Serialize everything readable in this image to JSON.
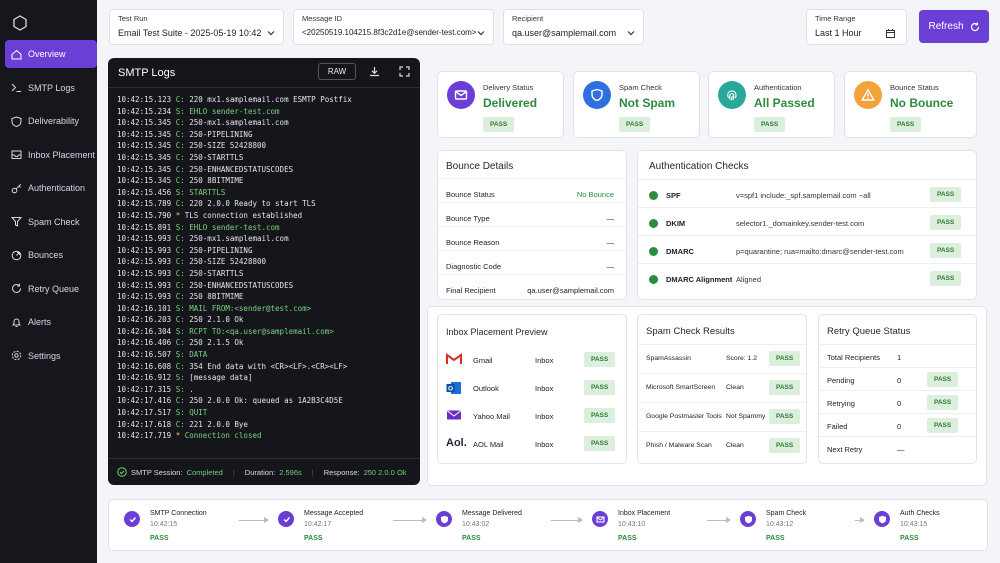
{
  "sidebar": {
    "items": [
      {
        "label": "Overview",
        "icon": "home-icon"
      },
      {
        "label": "SMTP Logs",
        "icon": "terminal-icon"
      },
      {
        "label": "Deliverability",
        "icon": "shield-icon"
      },
      {
        "label": "Inbox Placement",
        "icon": "inbox-icon"
      },
      {
        "label": "Authentication",
        "icon": "key-icon"
      },
      {
        "label": "Spam Check",
        "icon": "filter-icon"
      },
      {
        "label": "Bounces",
        "icon": "bounce-icon"
      },
      {
        "label": "Retry Queue",
        "icon": "retry-icon"
      },
      {
        "label": "Alerts",
        "icon": "bell-icon"
      },
      {
        "label": "Settings",
        "icon": "gear-icon"
      }
    ],
    "accent": "#6b3fd6"
  },
  "filters": {
    "test_run": {
      "label": "Test Run",
      "value": "Email Test Suite - 2025-05-19 10:42"
    },
    "message_id": {
      "label": "Message ID",
      "value": "<20250519.104215.8f3c2d1e@sender-test.com>"
    },
    "recipient": {
      "label": "Recipient",
      "value": "qa.user@samplemail.com"
    },
    "time_range": {
      "label": "Time Range",
      "value": "Last 1 Hour"
    },
    "refresh_label": "Refresh"
  },
  "logs": {
    "title": "SMTP Logs",
    "raw_label": "RAW",
    "lines": [
      {
        "t": "10:42:15.123",
        "tag": "C:",
        "msg": "220 mx1.samplemail.com ESMTP Postfix"
      },
      {
        "t": "10:42:15.234",
        "tag": "S:",
        "msg": "EHLO sender-test.com"
      },
      {
        "t": "10:42:15.345",
        "tag": "C:",
        "msg": "250-mx1.samplemail.com"
      },
      {
        "t": "10:42:15.345",
        "tag": "C:",
        "msg": "250-PIPELINING"
      },
      {
        "t": "10:42:15.345",
        "tag": "C:",
        "msg": "250-SIZE 52428800"
      },
      {
        "t": "10:42:15.345",
        "tag": "C:",
        "msg": "250-STARTTLS"
      },
      {
        "t": "10:42:15.345",
        "tag": "C:",
        "msg": "250-ENHANCEDSTATUSCODES"
      },
      {
        "t": "10:42:15.345",
        "tag": "C:",
        "msg": "250 8BITMIME"
      },
      {
        "t": "10:42:15.456",
        "tag": "S:",
        "msg": "STARTTLS"
      },
      {
        "t": "10:42:15.789",
        "tag": "C:",
        "msg": "220 2.0.0 Ready to start TLS"
      },
      {
        "t": "10:42:15.790",
        "tag": "*",
        "msg": "TLS connection established"
      },
      {
        "t": "10:42:15.891",
        "tag": "S:",
        "msg": "EHLO sender-test.com"
      },
      {
        "t": "10:42:15.993",
        "tag": "C:",
        "msg": "250-mx1.samplemail.com"
      },
      {
        "t": "10:42:15.993",
        "tag": "C:",
        "msg": "250-PIPELINING"
      },
      {
        "t": "10:42:15.993",
        "tag": "C:",
        "msg": "250-SIZE 52428800"
      },
      {
        "t": "10:42:15.993",
        "tag": "C:",
        "msg": "250-STARTTLS"
      },
      {
        "t": "10:42:15.993",
        "tag": "C:",
        "msg": "250-ENHANCEDSTATUSCODES"
      },
      {
        "t": "10:42:15.993",
        "tag": "C:",
        "msg": "250 8BITMIME"
      },
      {
        "t": "10:42:16.101",
        "tag": "S:",
        "msg": "MAIL FROM:<sender@test.com>"
      },
      {
        "t": "10:42:16.203",
        "tag": "C:",
        "msg": "250 2.1.0 Ok"
      },
      {
        "t": "10:42:16.304",
        "tag": "S:",
        "msg": "RCPT TO:<qa.user@samplemail.com>"
      },
      {
        "t": "10:42:16.406",
        "tag": "C:",
        "msg": "250 2.1.5 Ok"
      },
      {
        "t": "10:42:16.507",
        "tag": "S:",
        "msg": "DATA"
      },
      {
        "t": "10:42:16.608",
        "tag": "C:",
        "msg": "354 End data with <CR><LF>.<CR><LF>"
      },
      {
        "t": "10:42:16.912",
        "tag": "S:",
        "msg": "[message data]"
      },
      {
        "t": "10:42:17.315",
        "tag": "S:",
        "msg": "."
      },
      {
        "t": "10:42:17.416",
        "tag": "C:",
        "msg": "250 2.0.0 Ok: queued as 1A2B3C4D5E"
      },
      {
        "t": "10:42:17.517",
        "tag": "S:",
        "msg": "QUIT"
      },
      {
        "t": "10:42:17.618",
        "tag": "C:",
        "msg": "221 2.0.0 Bye"
      },
      {
        "t": "10:42:17.719",
        "tag": "*",
        "msg": "Connection closed"
      }
    ],
    "footer": {
      "session_label": "SMTP Session:",
      "session_value": "Completed",
      "duration_label": "Duration:",
      "duration_value": "2.596s",
      "response_label": "Response:",
      "response_value": "250 2.0.0 Ok"
    }
  },
  "status_cards": [
    {
      "title": "Delivery Status",
      "value": "Delivered",
      "badge": "PASS",
      "icon": "mail-icon",
      "color": "#6b3fd6"
    },
    {
      "title": "Spam Check",
      "value": "Not Spam",
      "badge": "PASS",
      "icon": "shield-icon",
      "color": "#2f6fe0"
    },
    {
      "title": "Authentication",
      "value": "All Passed",
      "badge": "PASS",
      "icon": "fingerprint-icon",
      "color": "#2aa79b"
    },
    {
      "title": "Bounce Status",
      "value": "No Bounce",
      "badge": "PASS",
      "icon": "warning-icon",
      "color": "#f2a33a"
    }
  ],
  "bounce": {
    "title": "Bounce Details",
    "rows": [
      {
        "k": "Bounce Status",
        "v": "No Bounce"
      },
      {
        "k": "Bounce Type",
        "v": "—"
      },
      {
        "k": "Bounce Reason",
        "v": "—"
      },
      {
        "k": "Diagnostic Code",
        "v": "—"
      },
      {
        "k": "Final Recipient",
        "v": "qa.user@samplemail.com"
      }
    ]
  },
  "auth": {
    "title": "Authentication Checks",
    "rows": [
      {
        "name": "SPF",
        "value": "v=spf1 include:_spf.samplemail.com ~all",
        "badge": "PASS"
      },
      {
        "name": "DKIM",
        "value": "selector1._domainkey.sender-test.com",
        "badge": "PASS"
      },
      {
        "name": "DMARC",
        "value": "p=quarantine; rua=mailto:dmarc@sender-test.com",
        "badge": "PASS"
      },
      {
        "name": "DMARC Alignment",
        "value": "Aligned",
        "badge": "PASS"
      }
    ]
  },
  "inbox": {
    "title": "Inbox Placement Preview",
    "rows": [
      {
        "name": "Gmail",
        "folder": "Inbox",
        "badge": "PASS",
        "icon": "gmail-icon"
      },
      {
        "name": "Outlook",
        "folder": "Inbox",
        "badge": "PASS",
        "icon": "outlook-icon"
      },
      {
        "name": "Yahoo Mail",
        "folder": "Inbox",
        "badge": "PASS",
        "icon": "yahoo-icon"
      },
      {
        "name": "AOL Mail",
        "folder": "Inbox",
        "badge": "PASS",
        "icon": "aol-icon",
        "logo_text": "Aol."
      }
    ]
  },
  "spam": {
    "title": "Spam Check Results",
    "rows": [
      {
        "name": "SpamAssassin",
        "value": "Score: 1.2",
        "badge": "PASS"
      },
      {
        "name": "Microsoft SmartScreen",
        "value": "Clean",
        "badge": "PASS"
      },
      {
        "name": "Google Postmaster Tools",
        "value": "Not Spammy",
        "badge": "PASS"
      },
      {
        "name": "Phish / Malware Scan",
        "value": "Clean",
        "badge": "PASS"
      }
    ]
  },
  "retry": {
    "title": "Retry Queue Status",
    "rows": [
      {
        "k": "Total Recipients",
        "v": "1",
        "badge": ""
      },
      {
        "k": "Pending",
        "v": "0",
        "badge": "PASS"
      },
      {
        "k": "Retrying",
        "v": "0",
        "badge": "PASS"
      },
      {
        "k": "Failed",
        "v": "0",
        "badge": "PASS"
      },
      {
        "k": "Next Retry",
        "v": "—",
        "badge": ""
      }
    ]
  },
  "flow": [
    {
      "name": "SMTP Connection",
      "time": "10:42:15",
      "status": "PASS",
      "icon": "check-icon"
    },
    {
      "name": "Message Accepted",
      "time": "10:42:17",
      "status": "PASS",
      "icon": "check-icon"
    },
    {
      "name": "Message Delivered",
      "time": "10:43:02",
      "status": "PASS",
      "icon": "shield-icon"
    },
    {
      "name": "Inbox Placement",
      "time": "10:43:10",
      "status": "PASS",
      "icon": "mail-icon"
    },
    {
      "name": "Spam Check",
      "time": "10:43:12",
      "status": "PASS",
      "icon": "shield-icon"
    },
    {
      "name": "Auth Checks",
      "time": "10:43:15",
      "status": "PASS",
      "icon": "shield-icon"
    }
  ]
}
